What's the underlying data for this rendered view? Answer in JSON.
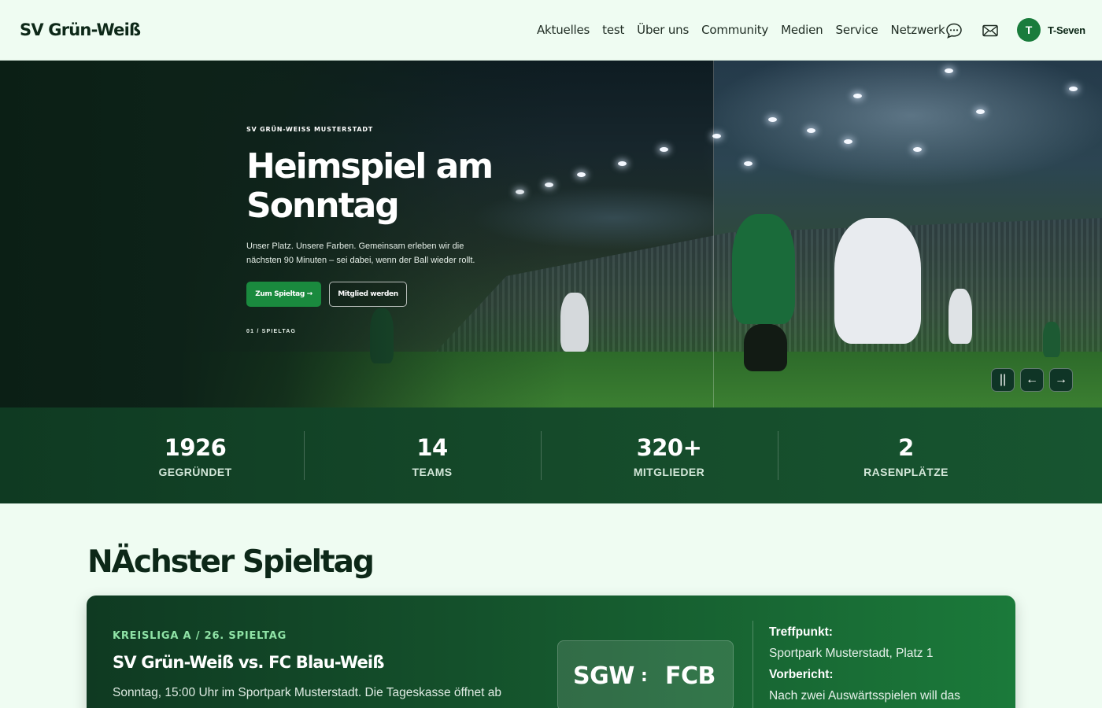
{
  "header": {
    "logo": "SV Grün-Weiß",
    "nav": [
      "Aktuelles",
      "test",
      "Über uns",
      "Community",
      "Medien",
      "Service",
      "Netzwerk"
    ],
    "icons": [
      "chat-icon",
      "mail-icon"
    ],
    "avatar_initial": "T",
    "username": "T-Seven"
  },
  "hero": {
    "kicker": "SV GRÜN-WEISS MUSTERSTADT",
    "title": "Heimspiel am Sonntag",
    "text": "Unser Platz. Unsere Farben. Gemeinsam erleben wir die nächsten 90 Minuten – sei dabei, wenn der Ball wieder rollt.",
    "primary_button": "Zum Spieltag →",
    "secondary_button": "Mitglied werden",
    "slide_counter": "01 / SPIELTAG",
    "controls": {
      "pause": "||",
      "prev": "←",
      "next": "→"
    }
  },
  "stats": [
    {
      "value": "1926",
      "label": "GEGRÜNDET"
    },
    {
      "value": "14",
      "label": "TEAMS"
    },
    {
      "value": "320+",
      "label": "MITGLIEDER"
    },
    {
      "value": "2",
      "label": "RASENPLÄTZE"
    }
  ],
  "next_match": {
    "section_title": "NÄchster Spieltag",
    "league": "KREISLIGA A / 26. SPIELTAG",
    "title": "SV Grün-Weiß vs. FC Blau-Weiß",
    "description": "Sonntag, 15:00 Uhr im Sportpark Musterstadt. Die Tageskasse öffnet ab",
    "home_short": "SGW",
    "score_separator": ":",
    "away_short": "FCB",
    "meeting_label": "Treffpunkt:",
    "meeting_value": "Sportpark Musterstadt, Platz 1",
    "preview_label": "Vorbericht:",
    "preview_value": "Nach zwei Auswärtsspielen will das"
  },
  "colors": {
    "background": "#effcf2",
    "brand_green": "#1a8a3e",
    "dark_green": "#0f3a22",
    "accent_light_green": "#8fe3a6"
  }
}
